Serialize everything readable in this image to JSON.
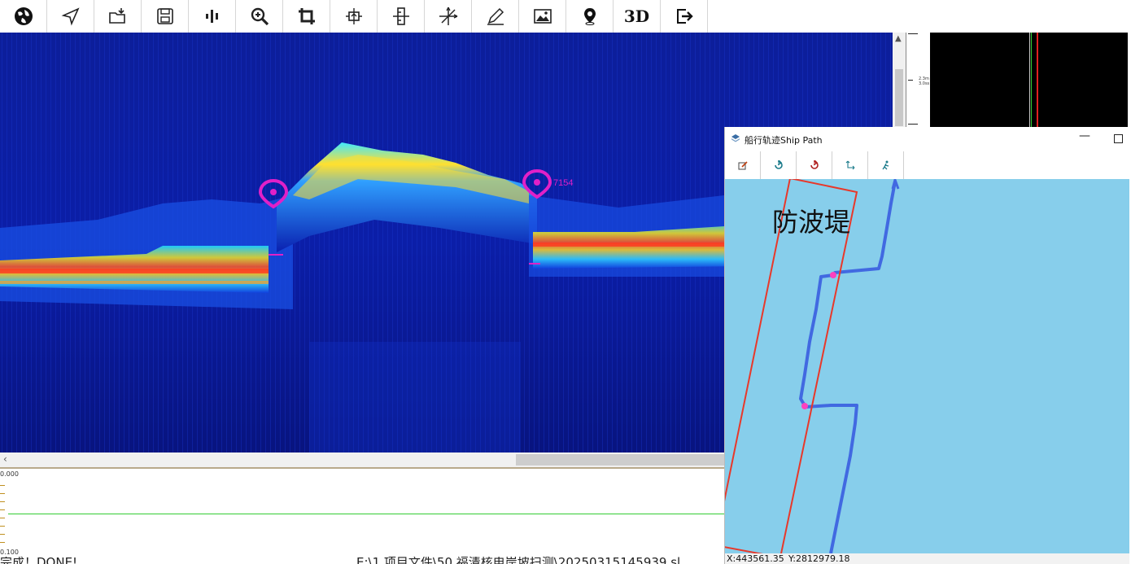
{
  "toolbar": {
    "buttons": [
      {
        "icon": "globe-icon"
      },
      {
        "icon": "navigate-arrow-icon"
      },
      {
        "icon": "open-folder-icon"
      },
      {
        "icon": "save-disk-icon"
      },
      {
        "icon": "waveform-icon"
      },
      {
        "icon": "zoom-in-icon"
      },
      {
        "icon": "crop-icon"
      },
      {
        "icon": "vertical-adjust-icon"
      },
      {
        "icon": "ruler-marker-icon"
      },
      {
        "icon": "crosshair-axis-icon"
      },
      {
        "icon": "pen-edit-icon"
      },
      {
        "icon": "image-icon"
      },
      {
        "icon": "location-pin-icon"
      },
      {
        "icon": "3d-view-icon",
        "label": "3D"
      },
      {
        "icon": "exit-icon"
      }
    ]
  },
  "sonar": {
    "markers": [
      {
        "label": "",
        "color": "#e020c8"
      },
      {
        "label": "7154",
        "color": "#e020c8"
      }
    ]
  },
  "side_ruler": {
    "label": "2.3m\n3.0ss"
  },
  "depth_panel": {
    "top_label": "0.000",
    "bottom_label": "0.100"
  },
  "status_bar": {
    "left_text": "完成！DONE!",
    "path_text": "E:\\1.项目文件\\50.福清核电岸坡扫测\\20250315145939.sl"
  },
  "ship_window": {
    "title": "船行轨迹Ship Path",
    "minimize_symbol": "—",
    "tool_buttons": [
      {
        "icon": "edit-icon"
      },
      {
        "icon": "refresh-icon"
      },
      {
        "icon": "refresh-red-icon"
      },
      {
        "icon": "path-axis-icon"
      },
      {
        "icon": "ship-run-icon"
      }
    ],
    "annotation_label": "防波堤",
    "coords": {
      "x": "X:443561.35",
      "y": "Y:2812979.18"
    },
    "map_color": "#87ceeb",
    "track_color": "#4169e1",
    "highlight_color": "#e8382a",
    "point_color": "#ff3fbf"
  }
}
